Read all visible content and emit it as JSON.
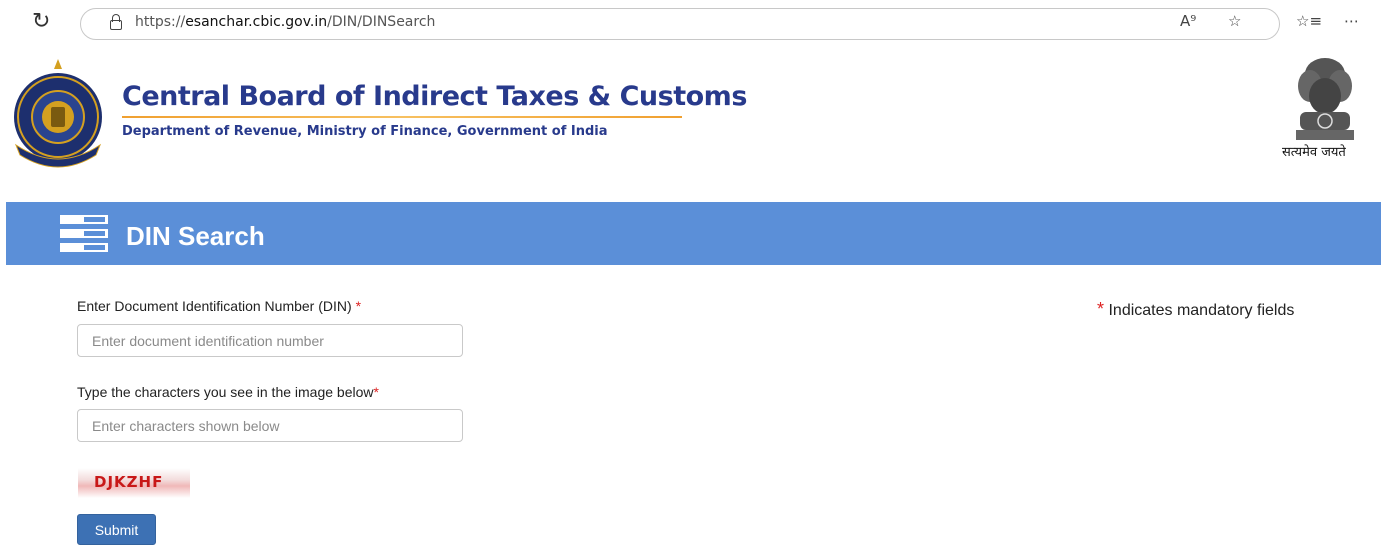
{
  "browser": {
    "url_prefix": "https://",
    "url_domain": "esanchar.cbic.gov.in",
    "url_path": "/DIN/DINSearch"
  },
  "header": {
    "title": "Central Board of Indirect Taxes & Customs",
    "subtitle": "Department of Revenue, Ministry of Finance, Government of India",
    "motto": "सत्यमेव जयते"
  },
  "banner": {
    "title": "DIN Search"
  },
  "form": {
    "din_label": "Enter Document Identification Number (DIN)",
    "din_required": "*",
    "din_placeholder": "Enter document identification number",
    "captcha_label": "Type the characters you see in the image below",
    "captcha_required": "*",
    "captcha_placeholder": "Enter characters shown below",
    "captcha_text": "DJKZHF",
    "submit_label": "Submit",
    "mandatory_star": "*",
    "mandatory_note": "Indicates mandatory fields"
  },
  "colors": {
    "banner": "#5b8fd8",
    "title": "#283a8c",
    "required": "#dd2222",
    "submit": "#3d71b4"
  }
}
